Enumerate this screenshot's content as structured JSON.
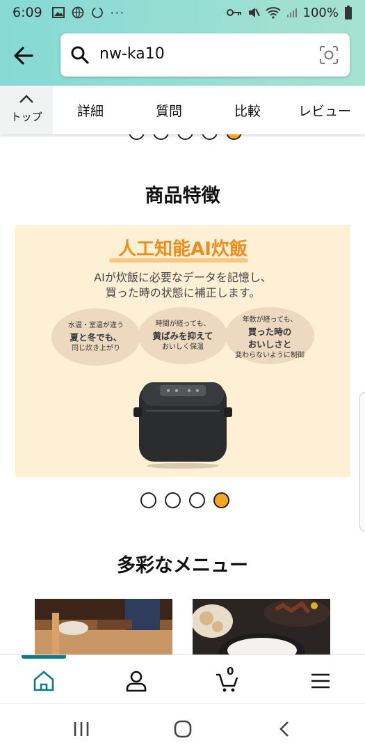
{
  "status": {
    "time": "6:09",
    "battery": "100%"
  },
  "search": {
    "value": "nw-ka10"
  },
  "tabs": {
    "top_label": "トップ",
    "items": [
      "詳細",
      "質問",
      "比較",
      "レビュー"
    ]
  },
  "carousel_top": {
    "count": 5,
    "active": 5
  },
  "section1": {
    "title": "商品特徴"
  },
  "promo": {
    "title": "人工知能AI炊飯",
    "lines": [
      "AIが炊飯に必要なデータを記憶し、",
      "買った時の状態に補正します。"
    ],
    "bubbles": [
      {
        "top": "水温・室温が違う",
        "main": "夏と冬でも、",
        "bottom": "同じ炊き上がり"
      },
      {
        "top": "時間が経っても、",
        "main": "黄ばみを抑えて",
        "bottom": "おいしく保温"
      },
      {
        "top": "年数が経っても、",
        "main": "買った時の\nおいしさと",
        "bottom": "変わらないように制御"
      }
    ]
  },
  "carousel_mid": {
    "count": 4,
    "active": 4
  },
  "section2": {
    "title": "多彩なメニュー"
  },
  "bottom_nav": {
    "cart_count": "0",
    "icons": [
      "home-icon",
      "account-icon",
      "cart-icon",
      "menu-icon"
    ]
  },
  "colors": {
    "header": "#86d9d5",
    "accent": "#0d7c85",
    "dot_active": "#f5a623",
    "promo_bg": "#fdf0d5",
    "promo_title": "#ef8c1e"
  }
}
